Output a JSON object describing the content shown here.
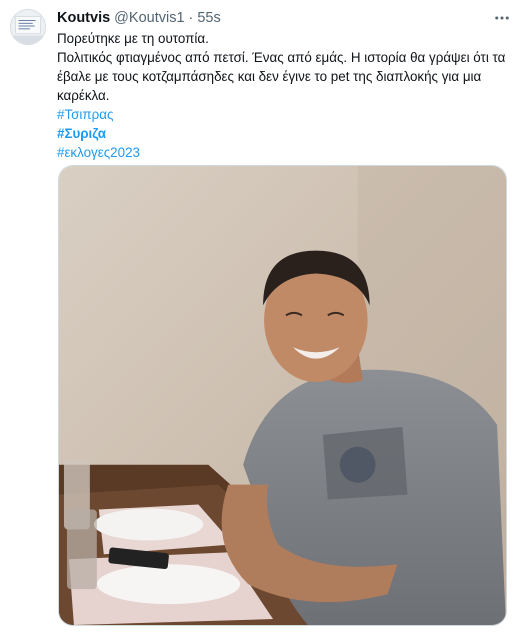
{
  "tweet": {
    "author": {
      "display_name": "Koutvis",
      "handle": "@Koutvis1",
      "separator": "·",
      "time": "55s"
    },
    "text": {
      "line1": "Πορεύτηκε με τη ουτοπία.",
      "line2": "Πολιτικός φτιαγμένος από πετσί. Ένας από εμάς. Η ιστορία θα γράψει ότι τα έβαλε με τους κοτζαμπάσηδες και δεν έγινε το pet της διαπλοκής για μια καρέκλα."
    },
    "hashtags": [
      {
        "label": "#Τσιπρας",
        "bold": false
      },
      {
        "label": "#Συριζα",
        "bold": true
      },
      {
        "label": "#εκλογες2023",
        "bold": false
      }
    ]
  },
  "colors": {
    "link": "#1d9bf0",
    "secondary_text": "#536471",
    "primary_text": "#0f1419"
  },
  "icons": [
    "more-options-icon"
  ]
}
